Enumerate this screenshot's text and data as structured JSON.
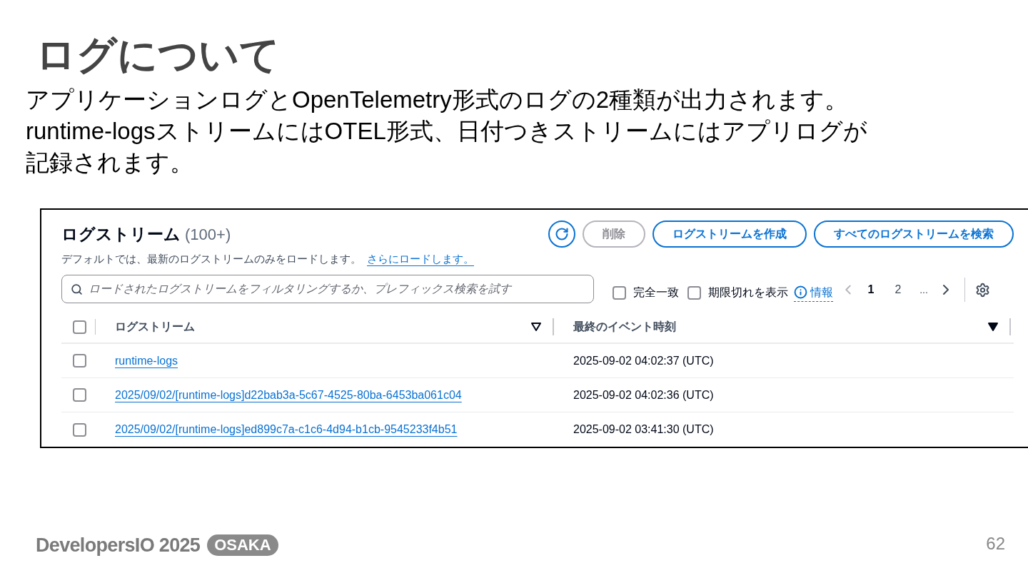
{
  "slide": {
    "title": "ログについて",
    "body_lines": [
      "アプリケーションログとOpenTelemetry形式のログの2種類が出力されます。",
      "runtime-logsストリームにはOTEL形式、日付つきストリームにはアプリログが",
      "記録されます。"
    ]
  },
  "panel": {
    "title": "ログストリーム",
    "count": "(100+)",
    "description": "デフォルトでは、最新のログストリームのみをロードします。",
    "load_more_link": "さらにロードします。",
    "buttons": [
      {
        "kind": "refresh",
        "disabled": false
      },
      {
        "kind": "text",
        "label": "削除",
        "disabled": true
      },
      {
        "kind": "text",
        "label": "ログストリームを作成",
        "disabled": false
      },
      {
        "kind": "text",
        "label": "すべてのログストリームを検索",
        "disabled": false
      }
    ],
    "search": {
      "placeholder": "ロードされたログストリームをフィルタリングするか、プレフィックス検索を試す"
    },
    "options": [
      {
        "label": "完全一致",
        "checked": false
      },
      {
        "label": "期限切れを表示",
        "checked": false
      }
    ],
    "info_link": "情報",
    "pagination": {
      "pages": [
        {
          "label": "1",
          "selected": true
        },
        {
          "label": "2",
          "selected": false
        }
      ],
      "ellipsis": "..."
    },
    "table": {
      "select_all_checked": false,
      "columns": [
        {
          "label": "ログストリーム",
          "sorted": false
        },
        {
          "label": "最終のイベント時刻",
          "sorted": true
        }
      ],
      "rows": [
        {
          "checked": false,
          "name": "runtime-logs",
          "time": "2025-09-02 04:02:37 (UTC)"
        },
        {
          "checked": false,
          "name": "2025/09/02/[runtime-logs]d22bab3a-5c67-4525-80ba-6453ba061c04",
          "time": "2025-09-02 04:02:36 (UTC)"
        },
        {
          "checked": false,
          "name": "2025/09/02/[runtime-logs]ed899c7a-c1c6-4d94-b1cb-9545233f4b51",
          "time": "2025-09-02 03:41:30 (UTC)"
        }
      ]
    }
  },
  "footer": {
    "brand": "DevelopersIO 2025",
    "badge": "OSAKA",
    "page_number": "62"
  }
}
